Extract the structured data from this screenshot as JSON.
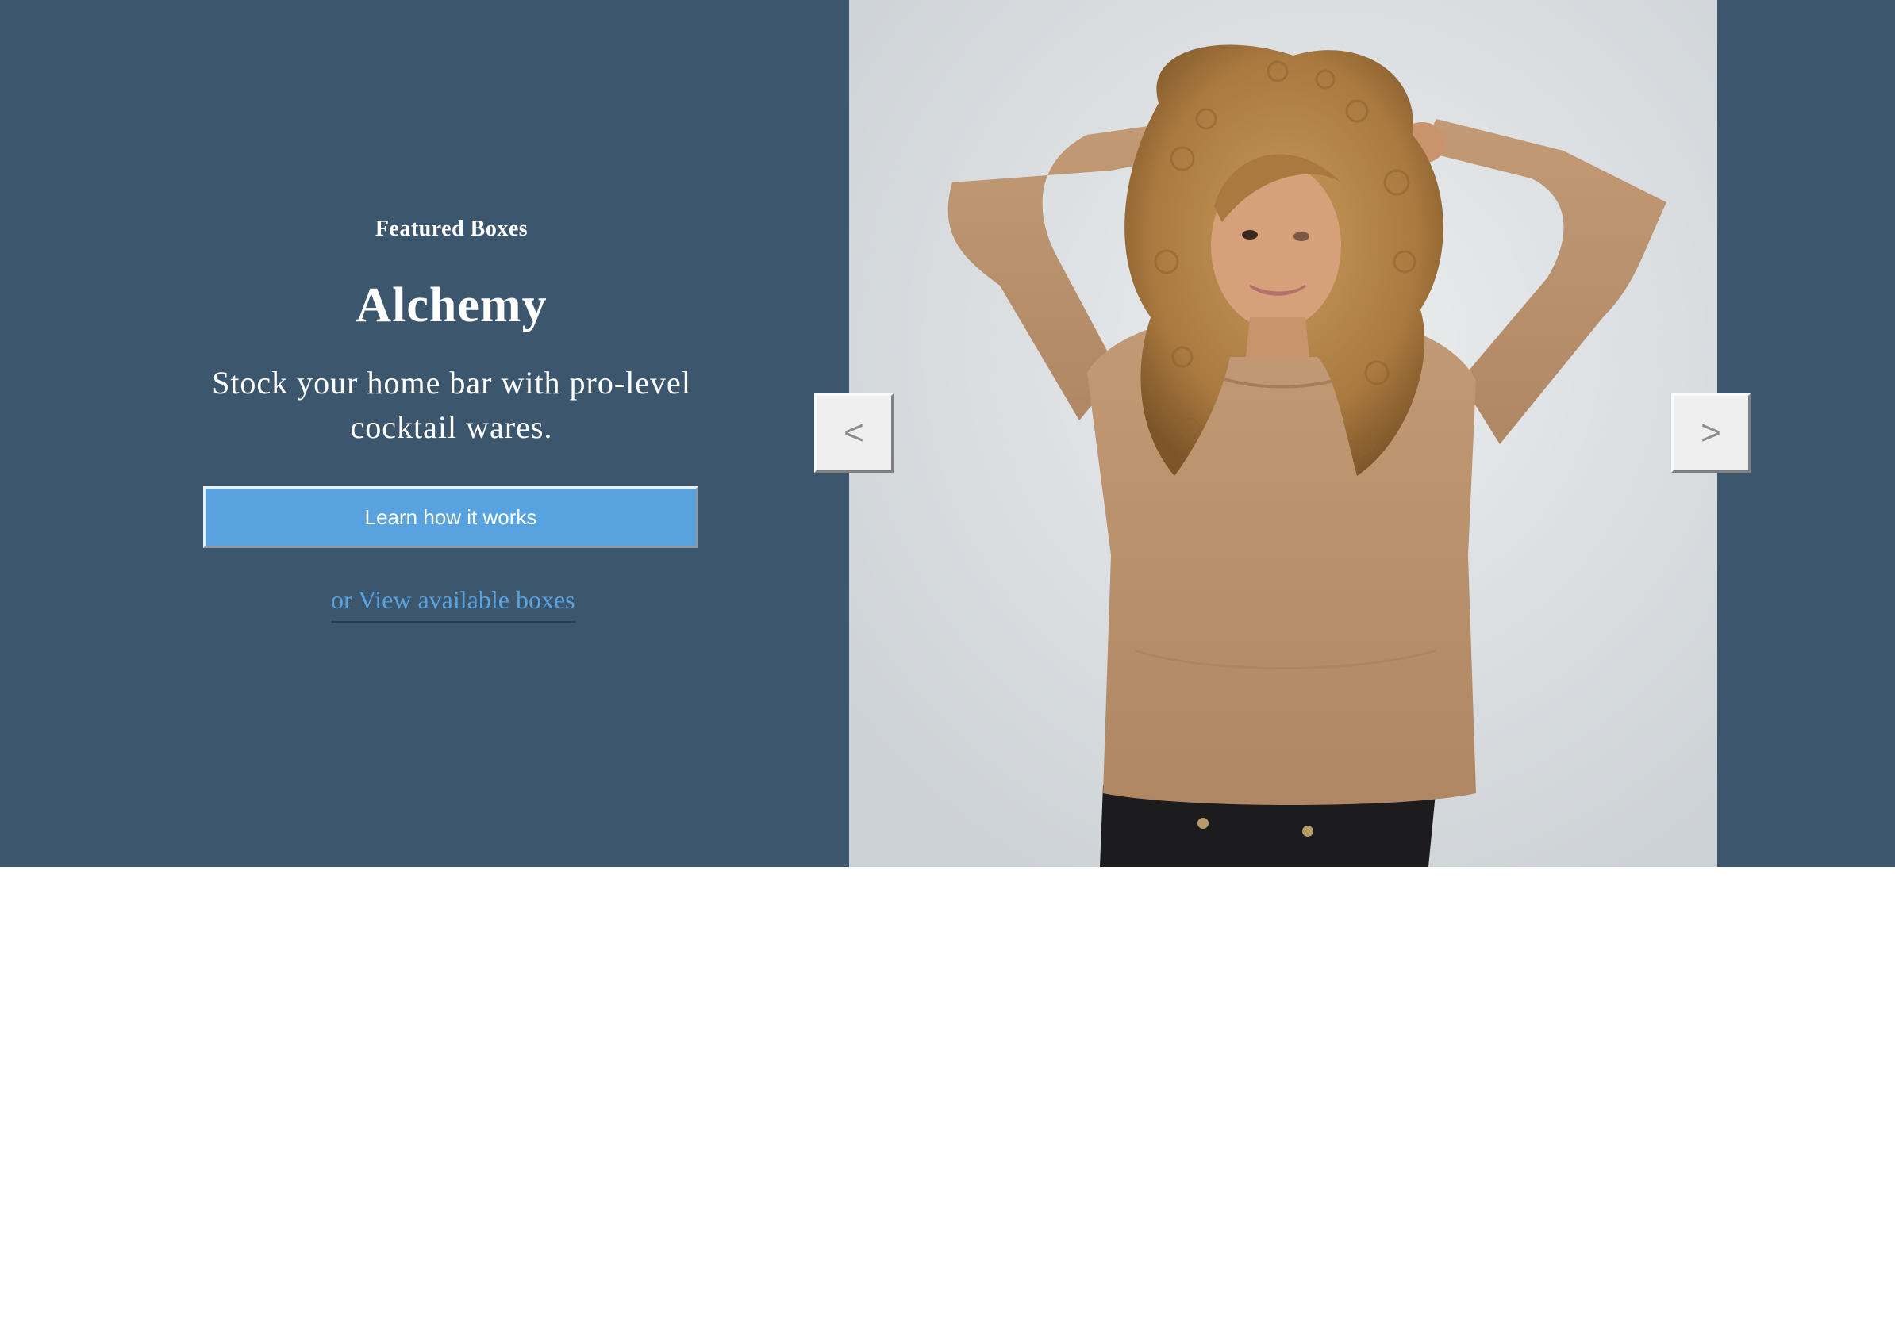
{
  "hero": {
    "eyebrow": "Featured Boxes",
    "title": "Alchemy",
    "subtitle": "Stock your home bar with pro-level cocktail wares.",
    "cta_label": "Learn how it works",
    "secondary_link": "or View available boxes"
  },
  "carousel": {
    "prev_label": "<",
    "next_label": ">",
    "image": "woman-curly-hair-tan-sweater-photo"
  },
  "colors": {
    "hero_background": "#3c576d",
    "accent": "#58a3df",
    "page_background": "#ffffff"
  }
}
